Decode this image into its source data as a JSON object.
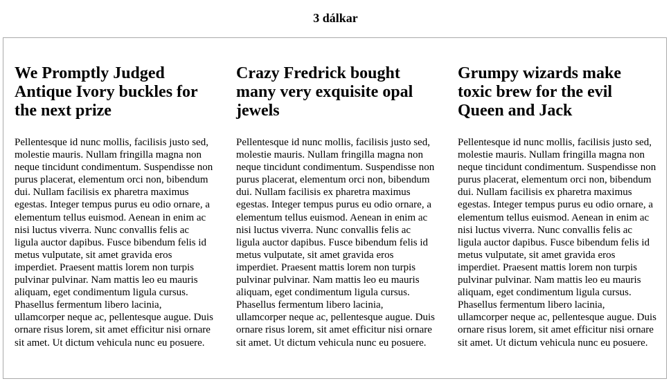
{
  "title": "3 dálkar",
  "columns": [
    {
      "heading": "We Promptly Judged Antique Ivory buckles for the next prize",
      "text": "Pellentesque id nunc mollis, facilisis justo sed, molestie mauris. Nullam fringilla magna non neque tincidunt condimentum. Suspendisse non purus placerat, elementum orci non, bibendum dui. Nullam facilisis ex pharetra maximus egestas. Integer tempus purus eu odio ornare, a elementum tellus euismod. Aenean in enim ac nisi luctus viverra. Nunc convallis felis ac ligula auctor dapibus. Fusce bibendum felis id metus vulputate, sit amet gravida eros imperdiet. Praesent mattis lorem non turpis pulvinar pulvinar. Nam mattis leo eu mauris aliquam, eget condimentum ligula cursus. Phasellus fermentum libero lacinia, ullamcorper neque ac, pellentesque augue. Duis ornare risus lorem, sit amet efficitur nisi ornare sit amet. Ut dictum vehicula nunc eu posuere."
    },
    {
      "heading": "Crazy Fredrick bought many very exquisite opal jewels",
      "text": "Pellentesque id nunc mollis, facilisis justo sed, molestie mauris. Nullam fringilla magna non neque tincidunt condimentum. Suspendisse non purus placerat, elementum orci non, bibendum dui. Nullam facilisis ex pharetra maximus egestas. Integer tempus purus eu odio ornare, a elementum tellus euismod. Aenean in enim ac nisi luctus viverra. Nunc convallis felis ac ligula auctor dapibus. Fusce bibendum felis id metus vulputate, sit amet gravida eros imperdiet. Praesent mattis lorem non turpis pulvinar pulvinar. Nam mattis leo eu mauris aliquam, eget condimentum ligula cursus. Phasellus fermentum libero lacinia, ullamcorper neque ac, pellentesque augue. Duis ornare risus lorem, sit amet efficitur nisi ornare sit amet. Ut dictum vehicula nunc eu posuere."
    },
    {
      "heading": "Grumpy wizards make toxic brew for the evil Queen and Jack",
      "text": "Pellentesque id nunc mollis, facilisis justo sed, molestie mauris. Nullam fringilla magna non neque tincidunt condimentum. Suspendisse non purus placerat, elementum orci non, bibendum dui. Nullam facilisis ex pharetra maximus egestas. Integer tempus purus eu odio ornare, a elementum tellus euismod. Aenean in enim ac nisi luctus viverra. Nunc convallis felis ac ligula auctor dapibus. Fusce bibendum felis id metus vulputate, sit amet gravida eros imperdiet. Praesent mattis lorem non turpis pulvinar pulvinar. Nam mattis leo eu mauris aliquam, eget condimentum ligula cursus. Phasellus fermentum libero lacinia, ullamcorper neque ac, pellentesque augue. Duis ornare risus lorem, sit amet efficitur nisi ornare sit amet. Ut dictum vehicula nunc eu posuere."
    }
  ]
}
